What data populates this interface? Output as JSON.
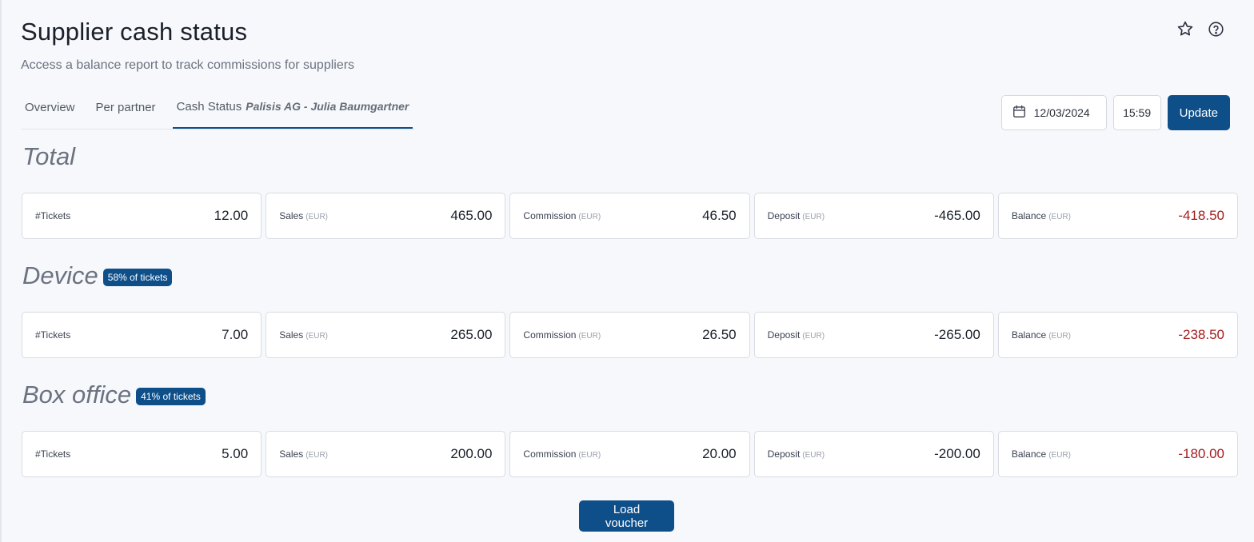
{
  "header": {
    "title": "Supplier cash status",
    "subtitle": "Access a balance report to track commissions for suppliers",
    "icons": [
      "star-icon",
      "help-icon"
    ]
  },
  "tabs": [
    {
      "label": "Overview",
      "active": false
    },
    {
      "label": "Per partner",
      "active": false
    },
    {
      "label": "Cash Status",
      "active": true,
      "partner": "Palisis AG - Julia Baumgartner"
    }
  ],
  "controls": {
    "date": "12/03/2024",
    "time": "15:59",
    "update_label": "Update"
  },
  "sections": [
    {
      "title": "Total",
      "badge": "",
      "cards": [
        {
          "label": "#Tickets",
          "unit": "",
          "value": "12.00",
          "negative": false
        },
        {
          "label": "Sales",
          "unit": "(EUR)",
          "value": "465.00",
          "negative": false
        },
        {
          "label": "Commission",
          "unit": "(EUR)",
          "value": "46.50",
          "negative": false
        },
        {
          "label": "Deposit",
          "unit": "(EUR)",
          "value": "-465.00",
          "negative": false
        },
        {
          "label": "Balance",
          "unit": "(EUR)",
          "value": "-418.50",
          "negative": true
        }
      ]
    },
    {
      "title": "Device",
      "badge": "58% of tickets",
      "cards": [
        {
          "label": "#Tickets",
          "unit": "",
          "value": "7.00",
          "negative": false
        },
        {
          "label": "Sales",
          "unit": "(EUR)",
          "value": "265.00",
          "negative": false
        },
        {
          "label": "Commission",
          "unit": "(EUR)",
          "value": "26.50",
          "negative": false
        },
        {
          "label": "Deposit",
          "unit": "(EUR)",
          "value": "-265.00",
          "negative": false
        },
        {
          "label": "Balance",
          "unit": "(EUR)",
          "value": "-238.50",
          "negative": true
        }
      ]
    },
    {
      "title": "Box office",
      "badge": "41% of tickets",
      "cards": [
        {
          "label": "#Tickets",
          "unit": "",
          "value": "5.00",
          "negative": false
        },
        {
          "label": "Sales",
          "unit": "(EUR)",
          "value": "200.00",
          "negative": false
        },
        {
          "label": "Commission",
          "unit": "(EUR)",
          "value": "20.00",
          "negative": false
        },
        {
          "label": "Deposit",
          "unit": "(EUR)",
          "value": "-200.00",
          "negative": false
        },
        {
          "label": "Balance",
          "unit": "(EUR)",
          "value": "-180.00",
          "negative": true
        }
      ]
    }
  ],
  "footer": {
    "load_voucher_label": "Load voucher"
  },
  "colors": {
    "accent": "#0e4f8a",
    "negative": "#a51d1d",
    "background": "#f6f8fb"
  }
}
